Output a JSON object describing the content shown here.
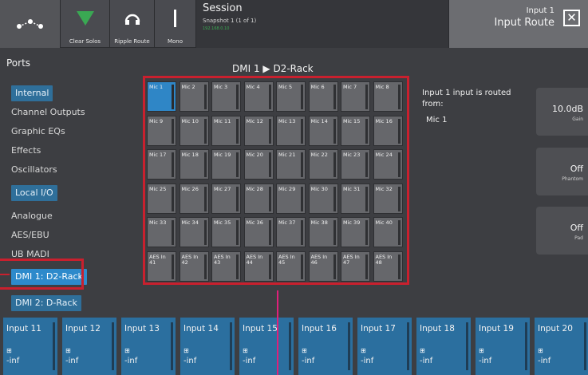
{
  "topbar": {
    "scenes_icon": "nodes-icon",
    "clear_solos": "Clear Solos",
    "ripple_route": "Ripple Route",
    "mono": "Mono",
    "session_title": "Session",
    "session_snapshot": "Snapshot 1 (1 of 1)",
    "session_ip": "192.168.0.10",
    "route_input": "Input 1",
    "route_title": "Input Route",
    "close_symbol": "✕"
  },
  "ports": {
    "title": "Ports",
    "items": [
      {
        "label": "Internal",
        "kind": "header"
      },
      {
        "label": "Channel Outputs",
        "kind": "item"
      },
      {
        "label": "Graphic EQs",
        "kind": "item"
      },
      {
        "label": "Effects",
        "kind": "item"
      },
      {
        "label": "Oscillators",
        "kind": "item"
      },
      {
        "label": "Local I/O",
        "kind": "header"
      },
      {
        "label": "Analogue",
        "kind": "item"
      },
      {
        "label": "AES/EBU",
        "kind": "item"
      },
      {
        "label": "UB MADI",
        "kind": "item"
      },
      {
        "label": "DMI 1: D2-Rack",
        "kind": "selected"
      },
      {
        "label": "DMI 2: D-Rack",
        "kind": "header"
      }
    ]
  },
  "grid": {
    "title": "DMI 1 ▶ D2-Rack",
    "selected": "Mic 1",
    "cells": [
      "Mic 1",
      "Mic 2",
      "Mic 3",
      "Mic 4",
      "Mic 5",
      "Mic 6",
      "Mic 7",
      "Mic 8",
      "Mic 9",
      "Mic 10",
      "Mic 11",
      "Mic 12",
      "Mic 13",
      "Mic 14",
      "Mic 15",
      "Mic 16",
      "Mic 17",
      "Mic 18",
      "Mic 19",
      "Mic 20",
      "Mic 21",
      "Mic 22",
      "Mic 23",
      "Mic 24",
      "Mic 25",
      "Mic 26",
      "Mic 27",
      "Mic 28",
      "Mic 29",
      "Mic 30",
      "Mic 31",
      "Mic 32",
      "Mic 33",
      "Mic 34",
      "Mic 35",
      "Mic 36",
      "Mic 37",
      "Mic 38",
      "Mic 39",
      "Mic 40",
      "AES In 41",
      "AES In 42",
      "AES In 43",
      "AES In 44",
      "AES In 45",
      "AES In 46",
      "AES In 47",
      "AES In 48"
    ]
  },
  "route_info": {
    "line1": "Input 1 input is routed",
    "line2": "from:",
    "source": "Mic 1"
  },
  "right_controls": [
    {
      "value": "10.0dB",
      "key": "Gain"
    },
    {
      "value": "Off",
      "key": "Phantom"
    },
    {
      "value": "Off",
      "key": "Pad"
    }
  ],
  "channels": [
    {
      "name": "Input 11",
      "level": "-inf"
    },
    {
      "name": "Input 12",
      "level": "-inf"
    },
    {
      "name": "Input 13",
      "level": "-inf"
    },
    {
      "name": "Input 14",
      "level": "-inf"
    },
    {
      "name": "Input 15",
      "level": "-inf"
    },
    {
      "name": "Input 16",
      "level": "-inf"
    },
    {
      "name": "Input 17",
      "level": "-inf"
    },
    {
      "name": "Input 18",
      "level": "-inf"
    },
    {
      "name": "Input 19",
      "level": "-inf"
    },
    {
      "name": "Input 20",
      "level": "-inf"
    }
  ],
  "colors": {
    "accent": "#2d8acb",
    "highlight": "#c9202e",
    "pointer": "#e0207a",
    "solo_green": "#3aa853"
  }
}
